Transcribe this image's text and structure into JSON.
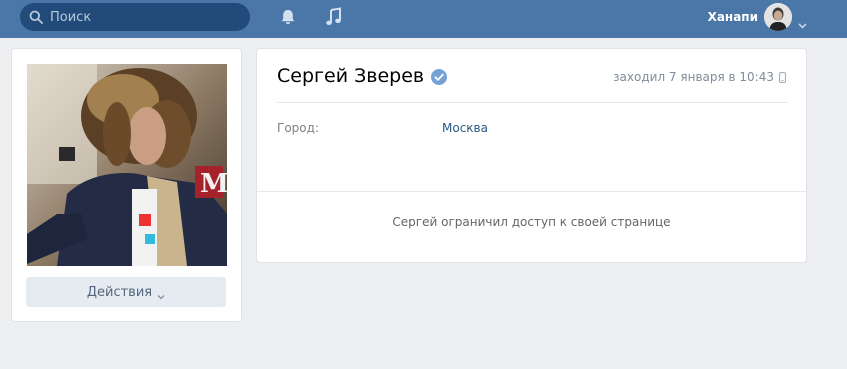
{
  "header": {
    "search_placeholder": "Поиск",
    "search_icon": "search-icon",
    "bell_icon": "bell-icon",
    "music_icon": "music-icon",
    "username": "Ханапи",
    "brand_color": "#4a76a8"
  },
  "profile_card": {
    "actions_label": "Действия"
  },
  "profile": {
    "name": "Сергей Зверев",
    "verified": true,
    "last_seen": "заходил 7 января в 10:43",
    "info": {
      "city_label": "Город:",
      "city_value": "Москва"
    },
    "restricted_message": "Сергей ограничил доступ к своей странице"
  }
}
